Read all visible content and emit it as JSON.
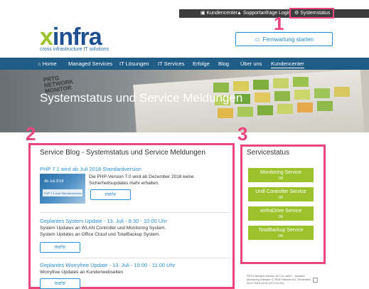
{
  "topbar": {
    "kundencenter": "Kundencenter",
    "supportanfrage": "Supportanfrage",
    "login": "Login",
    "systemstatus": "Systemstatus"
  },
  "markers": {
    "m1": "1",
    "m2": "2",
    "m3": "3"
  },
  "header": {
    "logo_x": "x",
    "logo_rest": "infra",
    "logo_tagline": "cross infrastructure IT solutions",
    "remote_button": "Fernwartung starten"
  },
  "nav": {
    "items": [
      "Home",
      "Managed Services",
      "IT Lösungen",
      "IT Services",
      "Erfolge",
      "Blog",
      "Über uns",
      "Kundencenter"
    ]
  },
  "hero": {
    "prtg_line1": "PRTG",
    "prtg_line2": "NETWORK",
    "prtg_line3": "MONITOR",
    "title": "Systemstatus und Service Meldungen"
  },
  "blog": {
    "title": "Service Blog - Systemstatus und Service Meldungen",
    "more_label": "mehr",
    "posts": [
      {
        "title": "PHP 7.1 wird ab Juli 2018 Standardversion",
        "text": "Die PHP-Version 7.0 wird ab Dezember 2018 keine Sicherheitsupdates mehr erhalten.",
        "thumb_line1": "Ab Juli 2018",
        "thumb_line2": "PHP 7.1 wird Standardversion"
      },
      {
        "title": "Geplantes System Update - 13. Juli - 8:30 - 10:00 Uhr",
        "text": "System Updates an WLAN Controller und Monitoring System. System Updates an Office Cloud und TotalBackup System."
      },
      {
        "title": "Geplantes Worryfree Update - 13. Juli - 10:00 - 11:00 Uhr",
        "text": "Worryfree Updates an Kundenwebseiten"
      }
    ]
  },
  "status": {
    "title": "Servicestatus",
    "services": [
      {
        "name": "Monitoring Service",
        "state": "OK"
      },
      {
        "name": "Unifi Controller Service",
        "state": "OK"
      },
      {
        "name": "xinfraDrive Service",
        "state": "OK"
      },
      {
        "name": "TotalBackup Service",
        "state": "OK"
      }
    ]
  },
  "footer": {
    "note": "PRTG Network Monitor 18.2.41.1652+ , Network Monitoring Software © 2018 Paessler AG, Generated: 09.07.2018 14:56 (UTC+01:00)"
  },
  "colors": {
    "nav": "#1f5d87",
    "accent_pink": "#e8467c",
    "service_green": "#9bc22b",
    "link_blue": "#2a8fd0",
    "logo_blue": "#1d4f91"
  }
}
